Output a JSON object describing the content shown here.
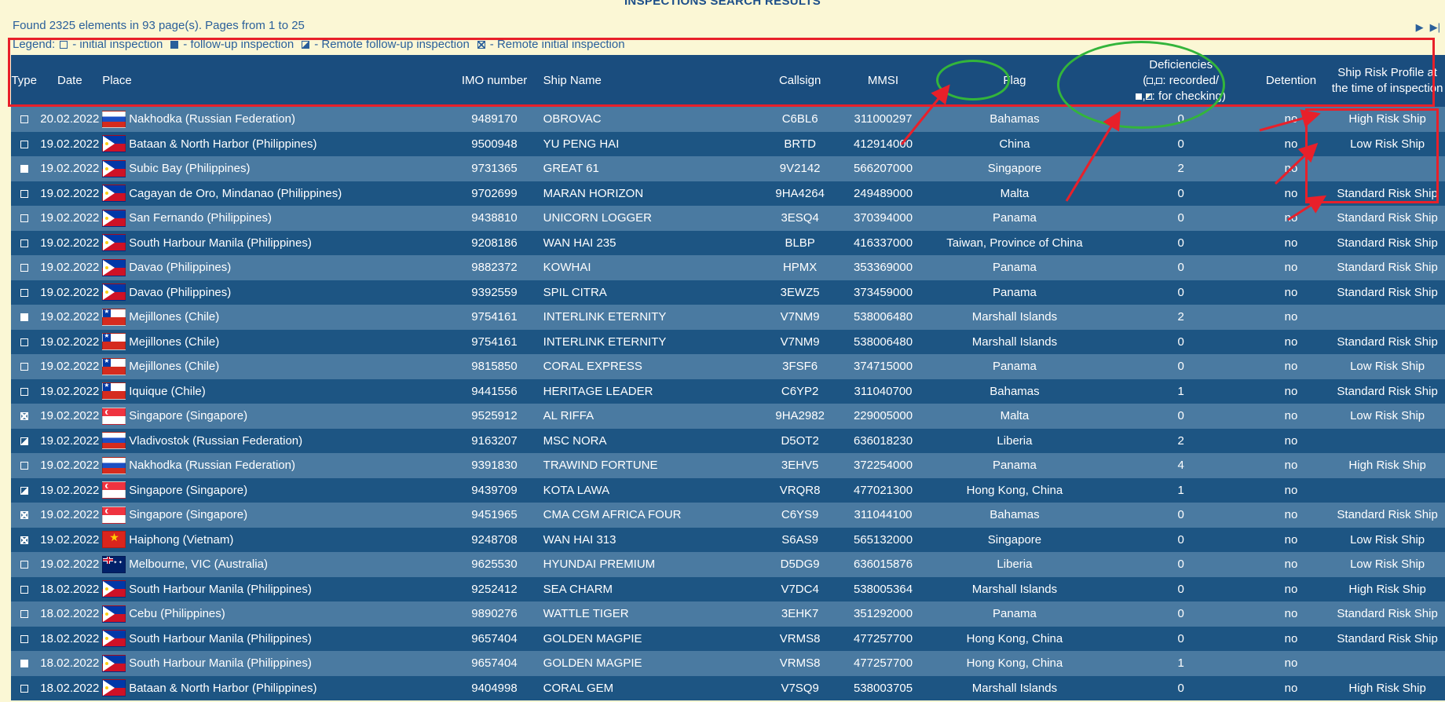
{
  "page": {
    "title": "INSPECTIONS SEARCH RESULTS",
    "found_text": "Found 2325 elements in 93 page(s). Pages from 1 to 25"
  },
  "pager": {
    "next_label": "▶",
    "last_label": "▶|"
  },
  "legend": {
    "label": "Legend:",
    "items": [
      {
        "symbol": "initial",
        "label": "- initial inspection"
      },
      {
        "symbol": "followup",
        "label": "- follow-up inspection"
      },
      {
        "symbol": "remote-followup",
        "label": "- Remote follow-up inspection"
      },
      {
        "symbol": "remote-initial",
        "label": "- Remote initial inspection"
      }
    ]
  },
  "columns": {
    "type": "Type",
    "date": "Date",
    "place": "Place",
    "imo": "IMO number",
    "ship": "Ship Name",
    "callsign": "Callsign",
    "mmsi": "MMSI",
    "flag": "Flag",
    "def_line1": "Deficiencies",
    "def_line2": ": recorded/",
    "def_line3": ": for checking)",
    "detention": "Detention",
    "risk": "Ship Risk Profile at the time of inspection"
  },
  "rows": [
    {
      "type": "initial",
      "date": "20.02.2022",
      "flag_icon": "ru",
      "place": "Nakhodka (Russian Federation)",
      "imo": "9489170",
      "ship": "OBROVAC",
      "callsign": "C6BL6",
      "mmsi": "311000297",
      "flag": "Bahamas",
      "deficiencies": "0",
      "detention": "no",
      "risk": "High Risk Ship"
    },
    {
      "type": "initial",
      "date": "19.02.2022",
      "flag_icon": "ph",
      "place": "Bataan & North Harbor (Philippines)",
      "imo": "9500948",
      "ship": "YU PENG HAI",
      "callsign": "BRTD",
      "mmsi": "412914000",
      "flag": "China",
      "deficiencies": "0",
      "detention": "no",
      "risk": "Low Risk Ship"
    },
    {
      "type": "followup",
      "date": "19.02.2022",
      "flag_icon": "ph",
      "place": "Subic Bay (Philippines)",
      "imo": "9731365",
      "ship": "GREAT 61",
      "callsign": "9V2142",
      "mmsi": "566207000",
      "flag": "Singapore",
      "deficiencies": "2",
      "detention": "no",
      "risk": ""
    },
    {
      "type": "initial",
      "date": "19.02.2022",
      "flag_icon": "ph",
      "place": "Cagayan de Oro, Mindanao (Philippines)",
      "imo": "9702699",
      "ship": "MARAN HORIZON",
      "callsign": "9HA4264",
      "mmsi": "249489000",
      "flag": "Malta",
      "deficiencies": "0",
      "detention": "no",
      "risk": "Standard Risk Ship"
    },
    {
      "type": "initial",
      "date": "19.02.2022",
      "flag_icon": "ph",
      "place": "San Fernando (Philippines)",
      "imo": "9438810",
      "ship": "UNICORN LOGGER",
      "callsign": "3ESQ4",
      "mmsi": "370394000",
      "flag": "Panama",
      "deficiencies": "0",
      "detention": "no",
      "risk": "Standard Risk Ship"
    },
    {
      "type": "initial",
      "date": "19.02.2022",
      "flag_icon": "ph",
      "place": "South Harbour Manila (Philippines)",
      "imo": "9208186",
      "ship": "WAN HAI 235",
      "callsign": "BLBP",
      "mmsi": "416337000",
      "flag": "Taiwan, Province of China",
      "deficiencies": "0",
      "detention": "no",
      "risk": "Standard Risk Ship"
    },
    {
      "type": "initial",
      "date": "19.02.2022",
      "flag_icon": "ph",
      "place": "Davao (Philippines)",
      "imo": "9882372",
      "ship": "KOWHAI",
      "callsign": "HPMX",
      "mmsi": "353369000",
      "flag": "Panama",
      "deficiencies": "0",
      "detention": "no",
      "risk": "Standard Risk Ship"
    },
    {
      "type": "initial",
      "date": "19.02.2022",
      "flag_icon": "ph",
      "place": "Davao (Philippines)",
      "imo": "9392559",
      "ship": "SPIL CITRA",
      "callsign": "3EWZ5",
      "mmsi": "373459000",
      "flag": "Panama",
      "deficiencies": "0",
      "detention": "no",
      "risk": "Standard Risk Ship"
    },
    {
      "type": "followup",
      "date": "19.02.2022",
      "flag_icon": "cl",
      "place": "Mejillones (Chile)",
      "imo": "9754161",
      "ship": "INTERLINK ETERNITY",
      "callsign": "V7NM9",
      "mmsi": "538006480",
      "flag": "Marshall Islands",
      "deficiencies": "2",
      "detention": "no",
      "risk": ""
    },
    {
      "type": "initial",
      "date": "19.02.2022",
      "flag_icon": "cl",
      "place": "Mejillones (Chile)",
      "imo": "9754161",
      "ship": "INTERLINK ETERNITY",
      "callsign": "V7NM9",
      "mmsi": "538006480",
      "flag": "Marshall Islands",
      "deficiencies": "0",
      "detention": "no",
      "risk": "Standard Risk Ship"
    },
    {
      "type": "initial",
      "date": "19.02.2022",
      "flag_icon": "cl",
      "place": "Mejillones (Chile)",
      "imo": "9815850",
      "ship": "CORAL EXPRESS",
      "callsign": "3FSF6",
      "mmsi": "374715000",
      "flag": "Panama",
      "deficiencies": "0",
      "detention": "no",
      "risk": "Low Risk Ship"
    },
    {
      "type": "initial",
      "date": "19.02.2022",
      "flag_icon": "cl",
      "place": "Iquique (Chile)",
      "imo": "9441556",
      "ship": "HERITAGE LEADER",
      "callsign": "C6YP2",
      "mmsi": "311040700",
      "flag": "Bahamas",
      "deficiencies": "1",
      "detention": "no",
      "risk": "Standard Risk Ship"
    },
    {
      "type": "remote-initial",
      "date": "19.02.2022",
      "flag_icon": "sg",
      "place": "Singapore (Singapore)",
      "imo": "9525912",
      "ship": "AL RIFFA",
      "callsign": "9HA2982",
      "mmsi": "229005000",
      "flag": "Malta",
      "deficiencies": "0",
      "detention": "no",
      "risk": "Low Risk Ship"
    },
    {
      "type": "remote-followup",
      "date": "19.02.2022",
      "flag_icon": "ru",
      "place": "Vladivostok (Russian Federation)",
      "imo": "9163207",
      "ship": "MSC NORA",
      "callsign": "D5OT2",
      "mmsi": "636018230",
      "flag": "Liberia",
      "deficiencies": "2",
      "detention": "no",
      "risk": ""
    },
    {
      "type": "initial",
      "date": "19.02.2022",
      "flag_icon": "ru",
      "place": "Nakhodka (Russian Federation)",
      "imo": "9391830",
      "ship": "TRAWIND FORTUNE",
      "callsign": "3EHV5",
      "mmsi": "372254000",
      "flag": "Panama",
      "deficiencies": "4",
      "detention": "no",
      "risk": "High Risk Ship"
    },
    {
      "type": "remote-followup",
      "date": "19.02.2022",
      "flag_icon": "sg",
      "place": "Singapore (Singapore)",
      "imo": "9439709",
      "ship": "KOTA LAWA",
      "callsign": "VRQR8",
      "mmsi": "477021300",
      "flag": "Hong Kong, China",
      "deficiencies": "1",
      "detention": "no",
      "risk": ""
    },
    {
      "type": "remote-initial",
      "date": "19.02.2022",
      "flag_icon": "sg",
      "place": "Singapore (Singapore)",
      "imo": "9451965",
      "ship": "CMA CGM AFRICA FOUR",
      "callsign": "C6YS9",
      "mmsi": "311044100",
      "flag": "Bahamas",
      "deficiencies": "0",
      "detention": "no",
      "risk": "Standard Risk Ship"
    },
    {
      "type": "remote-initial",
      "date": "19.02.2022",
      "flag_icon": "vn",
      "place": "Haiphong (Vietnam)",
      "imo": "9248708",
      "ship": "WAN HAI 313",
      "callsign": "S6AS9",
      "mmsi": "565132000",
      "flag": "Singapore",
      "deficiencies": "0",
      "detention": "no",
      "risk": "Low Risk Ship"
    },
    {
      "type": "initial",
      "date": "19.02.2022",
      "flag_icon": "au",
      "place": "Melbourne, VIC (Australia)",
      "imo": "9625530",
      "ship": "HYUNDAI PREMIUM",
      "callsign": "D5DG9",
      "mmsi": "636015876",
      "flag": "Liberia",
      "deficiencies": "0",
      "detention": "no",
      "risk": "Low Risk Ship"
    },
    {
      "type": "initial",
      "date": "18.02.2022",
      "flag_icon": "ph",
      "place": "South Harbour Manila (Philippines)",
      "imo": "9252412",
      "ship": "SEA CHARM",
      "callsign": "V7DC4",
      "mmsi": "538005364",
      "flag": "Marshall Islands",
      "deficiencies": "0",
      "detention": "no",
      "risk": "High Risk Ship"
    },
    {
      "type": "initial",
      "date": "18.02.2022",
      "flag_icon": "ph",
      "place": "Cebu (Philippines)",
      "imo": "9890276",
      "ship": "WATTLE TIGER",
      "callsign": "3EHK7",
      "mmsi": "351292000",
      "flag": "Panama",
      "deficiencies": "0",
      "detention": "no",
      "risk": "Standard Risk Ship"
    },
    {
      "type": "initial",
      "date": "18.02.2022",
      "flag_icon": "ph",
      "place": "South Harbour Manila (Philippines)",
      "imo": "9657404",
      "ship": "GOLDEN MAGPIE",
      "callsign": "VRMS8",
      "mmsi": "477257700",
      "flag": "Hong Kong, China",
      "deficiencies": "0",
      "detention": "no",
      "risk": "Standard Risk Ship"
    },
    {
      "type": "followup",
      "date": "18.02.2022",
      "flag_icon": "ph",
      "place": "South Harbour Manila (Philippines)",
      "imo": "9657404",
      "ship": "GOLDEN MAGPIE",
      "callsign": "VRMS8",
      "mmsi": "477257700",
      "flag": "Hong Kong, China",
      "deficiencies": "1",
      "detention": "no",
      "risk": ""
    },
    {
      "type": "initial",
      "date": "18.02.2022",
      "flag_icon": "ph",
      "place": "Bataan & North Harbor (Philippines)",
      "imo": "9404998",
      "ship": "CORAL GEM",
      "callsign": "V7SQ9",
      "mmsi": "538003705",
      "flag": "Marshall Islands",
      "deficiencies": "0",
      "detention": "no",
      "risk": "High Risk Ship"
    }
  ],
  "colors": {
    "background": "#fbf7d5",
    "header_bg": "#1a4d7e",
    "row_light": "#4a7aa1",
    "row_dark": "#1d5583",
    "annotation_red": "#e8202a",
    "annotation_green": "#33b53b"
  }
}
